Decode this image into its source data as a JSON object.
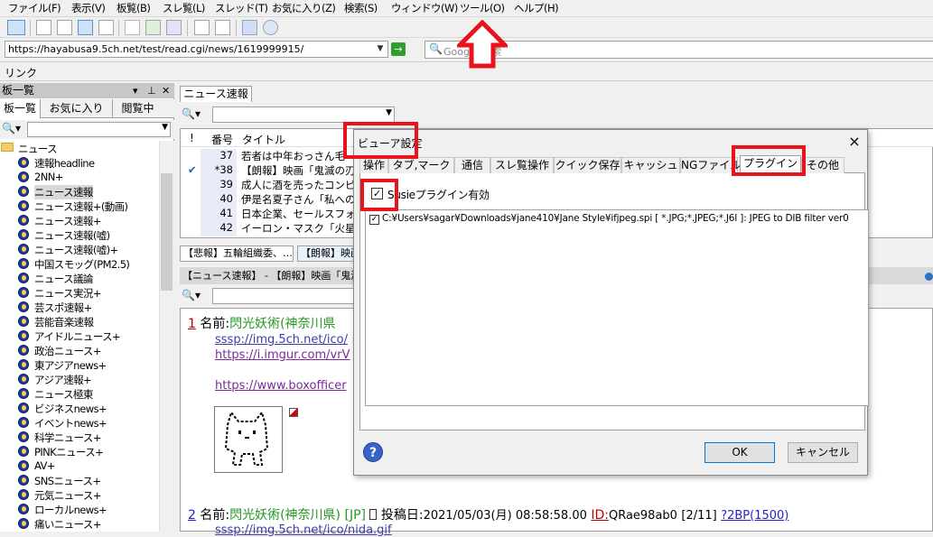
{
  "menu": [
    "ファイル(F)",
    "表示(V)",
    "板覧(B)",
    "スレ覧(L)",
    "スレッド(T)",
    "お気に入り(Z)",
    "検索(S)",
    "ウィンドウ(W)",
    "ツール(O)",
    "ヘルプ(H)"
  ],
  "address": {
    "url": "https://hayabusa9.5ch.net/test/read.cgi/news/1619999915/",
    "go_icon": "→"
  },
  "google_search": {
    "placeholder": "Google 検索"
  },
  "linkbar": {
    "label": "リンク"
  },
  "left_panel": {
    "title": "板一覧",
    "tabs": [
      "板一覧",
      "お気に入り",
      "閲覧中"
    ],
    "tree": [
      {
        "label": "ニュース",
        "type": "folder"
      },
      {
        "label": "速報headline",
        "type": "board"
      },
      {
        "label": "2NN+",
        "type": "board"
      },
      {
        "label": "ニュース速報",
        "type": "board"
      },
      {
        "label": "ニュース速報+(動画)",
        "type": "board"
      },
      {
        "label": "ニュース速報+",
        "type": "board"
      },
      {
        "label": "ニュース速報(嘘)",
        "type": "board"
      },
      {
        "label": "ニュース速報(嘘)+",
        "type": "board"
      },
      {
        "label": "中国スモッグ(PM2.5)",
        "type": "board"
      },
      {
        "label": "ニュース議論",
        "type": "board"
      },
      {
        "label": "ニュース実況+",
        "type": "board"
      },
      {
        "label": "芸スポ速報+",
        "type": "board"
      },
      {
        "label": "芸能音楽速報",
        "type": "board"
      },
      {
        "label": "アイドルニュース+",
        "type": "board"
      },
      {
        "label": "政治ニュース+",
        "type": "board"
      },
      {
        "label": "東アジアnews+",
        "type": "board"
      },
      {
        "label": "アジア速報+",
        "type": "board"
      },
      {
        "label": "ニュース極東",
        "type": "board"
      },
      {
        "label": "ビジネスnews+",
        "type": "board"
      },
      {
        "label": "イベントnews+",
        "type": "board"
      },
      {
        "label": "科学ニュース+",
        "type": "board"
      },
      {
        "label": "PINKニュース+",
        "type": "board"
      },
      {
        "label": "AV+",
        "type": "board"
      },
      {
        "label": "SNSニュース+",
        "type": "board"
      },
      {
        "label": "元気ニュース+",
        "type": "board"
      },
      {
        "label": "ローカルnews+",
        "type": "board"
      },
      {
        "label": "痛いニュース+",
        "type": "board"
      }
    ]
  },
  "main": {
    "tab_label": "ニュース速報",
    "list_header": {
      "mark": "!",
      "num": "番号",
      "title": "タイトル"
    },
    "threads": [
      {
        "num": "37",
        "title": "若者は中年おっさん毛",
        "mark": ""
      },
      {
        "num": "*38",
        "title": "【朗報】映画「鬼滅の刃」",
        "mark": "✔"
      },
      {
        "num": "39",
        "title": "成人に酒を売ったコンビ",
        "mark": ""
      },
      {
        "num": "40",
        "title": "伊是名夏子さん「私への",
        "mark": ""
      },
      {
        "num": "41",
        "title": "日本企業、セールスフォ",
        "mark": ""
      },
      {
        "num": "42",
        "title": "イーロン・マスク「火星に",
        "mark": ""
      }
    ],
    "mini_tabs": [
      "【悲報】五輪組織委、…",
      "【朗報】映画"
    ],
    "thread_title": "【ニュース速報】 - 【朗報】映画「鬼滅の",
    "posts": [
      {
        "num": "1",
        "name_label": "名前:",
        "name": "閃光妖術(神奈川県",
        "links": [
          "sssp://img.5ch.net/ico/",
          "https://i.imgur.com/vrV",
          "https://www.boxofficer"
        ]
      },
      {
        "num": "2",
        "name_label": "名前:",
        "name": "閃光妖術(神奈川県)",
        "country": "[JP]",
        "date_label": "投稿日:",
        "date": "2021/05/03(月) 08:58:58.00",
        "id_label": "ID:",
        "id": "QRae98ab0",
        "count": "[2/11]",
        "be": "?2BP(1500)",
        "link": "sssp://img.5ch.net/ico/nida.gif"
      }
    ]
  },
  "dialog": {
    "title": "ビューア設定",
    "close_icon": "×",
    "tabs": [
      "操作",
      "タブ,マーク",
      "通信",
      "スレ覧操作",
      "クイック保存",
      "キャッシュ",
      "NGファイル",
      "プラグイン",
      "その他"
    ],
    "active_tab": "プラグイン",
    "susie_label": "Susieプラグイン有効",
    "susie_checked": true,
    "plugins": [
      {
        "checked": true,
        "text": "C:¥Users¥sagar¥Downloads¥jane410¥Jane Style¥ifjpeg.spi [ *.JPG;*.JPEG;*.J6I ]: JPEG to DIB filter ver0"
      }
    ],
    "help_icon": "?",
    "ok_label": "OK",
    "cancel_label": "キャンセル"
  },
  "annotation_color": "#e8131b"
}
